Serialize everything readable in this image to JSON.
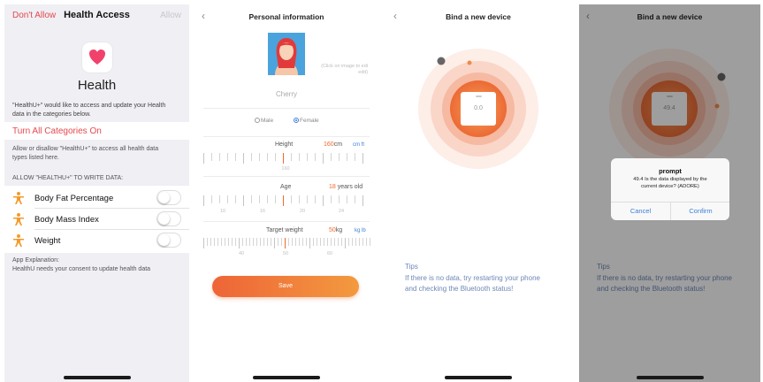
{
  "health_access": {
    "nav_left": "Don't Allow",
    "nav_title": "Health Access",
    "nav_right": "Allow",
    "app_title": "Health",
    "desc_line1": "\"HealthU+\" would like to access and update your Health",
    "desc_line2": "data in the categories below.",
    "turn_all_on": "Turn All Categories On",
    "allow_line1": "Allow or disallow \"HealthU+\" to access all health data",
    "allow_line2": "types listed here.",
    "section_header": "ALLOW \"HEALTHU+\" TO WRITE DATA:",
    "items": [
      {
        "label": "Body Fat Percentage",
        "enabled": false,
        "icon": "person-figure-icon"
      },
      {
        "label": "Body Mass Index",
        "enabled": false,
        "icon": "person-figure-icon"
      },
      {
        "label": "Weight",
        "enabled": false,
        "icon": "person-figure-icon"
      }
    ],
    "app_explanation_title": "App Explanation:",
    "app_explanation_text": "HealthU needs your consent to update health data",
    "accent_color": "#e5484d",
    "icon_color": "#f39a2b"
  },
  "personal_info": {
    "nav_title": "Personal information",
    "avatar_hint_line1": "(Click on image to edi",
    "avatar_hint_line2": "edit)",
    "nickname": "Cherry",
    "gender_male": "Male",
    "gender_female": "Female",
    "selected_gender": "Female",
    "height_label": "Height",
    "height_value": "160",
    "height_unit": "cm",
    "height_alt_unit": "cm ft",
    "height_ticks": [
      "160"
    ],
    "age_label": "Age",
    "age_value": "18",
    "age_unit": "years old",
    "age_ticks": [
      "10",
      "16",
      "20",
      "24"
    ],
    "weight_label": "Target weight",
    "weight_value": "50",
    "weight_unit": "kg",
    "weight_alt_unit": "kg lb",
    "weight_ticks": [
      "40",
      "50",
      "60"
    ],
    "save_label": "Save",
    "accent_color": "#f06a2a"
  },
  "bind_device": {
    "nav_title": "Bind a new device",
    "display_value": "0.0",
    "tips_title": "Tips",
    "tips_line1": "If there is no data, try restarting your phone",
    "tips_line2": "and checking the Bluetooth status!"
  },
  "bind_device_prompt": {
    "nav_title": "Bind a new device",
    "display_value": "49.4",
    "tips_title": "Tips",
    "tips_line1": "If there is no data, try restarting your phone",
    "tips_line2": "and checking the Bluetooth status!",
    "dialog_title": "prompt",
    "dialog_line1": "49.4 Is the data displayed by the",
    "dialog_line2": "current device? (ADORE)",
    "cancel_label": "Cancel",
    "confirm_label": "Confirm"
  }
}
